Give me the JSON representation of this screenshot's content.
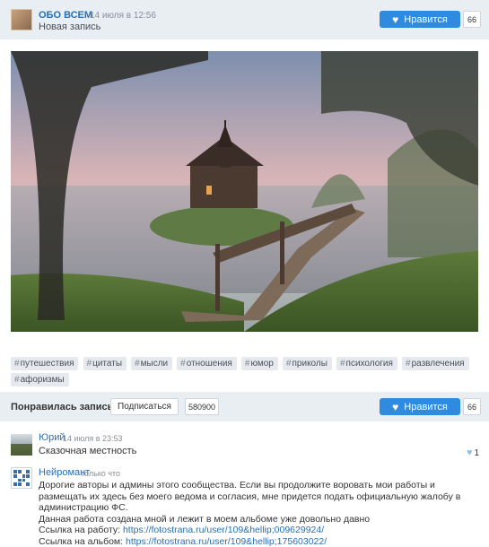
{
  "post": {
    "group_name": "ОБО ВСЕМ",
    "date": "14 июля в 12:56",
    "subtitle": "Новая запись",
    "like_label": "Нравится",
    "like_count": "66"
  },
  "tags": [
    "путешествия",
    "цитаты",
    "мысли",
    "отношения",
    "юмор",
    "приколы",
    "психология",
    "развлечения",
    "афоризмы"
  ],
  "bar": {
    "question": "Понравилась запись?",
    "subscribe_label": "Подписаться",
    "subscribers_count": "580900",
    "like_label": "Нравится",
    "like_count": "66"
  },
  "comments": [
    {
      "author": "Юрий",
      "date": "14 июля в 23:53",
      "text": "Сказочная местность",
      "likes": "1"
    },
    {
      "author": "Нейромант",
      "date": "только что",
      "lines": [
        "Дорогие авторы и админы этого сообщества. Если вы продолжите воровать мои работы и размещать их здесь без моего ведома и согласия, мне придется подать официальную жалобу в администрацию ФС.",
        "Данная работа создана мной и лежит в моем альбоме уже довольно давно"
      ],
      "work_link_label": "Ссылка на работу:",
      "work_link": "https://fotostrana.ru/user/109&hellip;009629924/",
      "album_link_label": "Ссылка на альбом:",
      "album_link": "https://fotostrana.ru/user/109&hellip;175603022/"
    }
  ],
  "colors": {
    "accent_blue": "#2f8be0",
    "link_blue": "#2a6fb3",
    "bar_bg": "#e9eef3"
  },
  "icons": {
    "heart": "heart-icon",
    "hash": "hash-icon"
  }
}
